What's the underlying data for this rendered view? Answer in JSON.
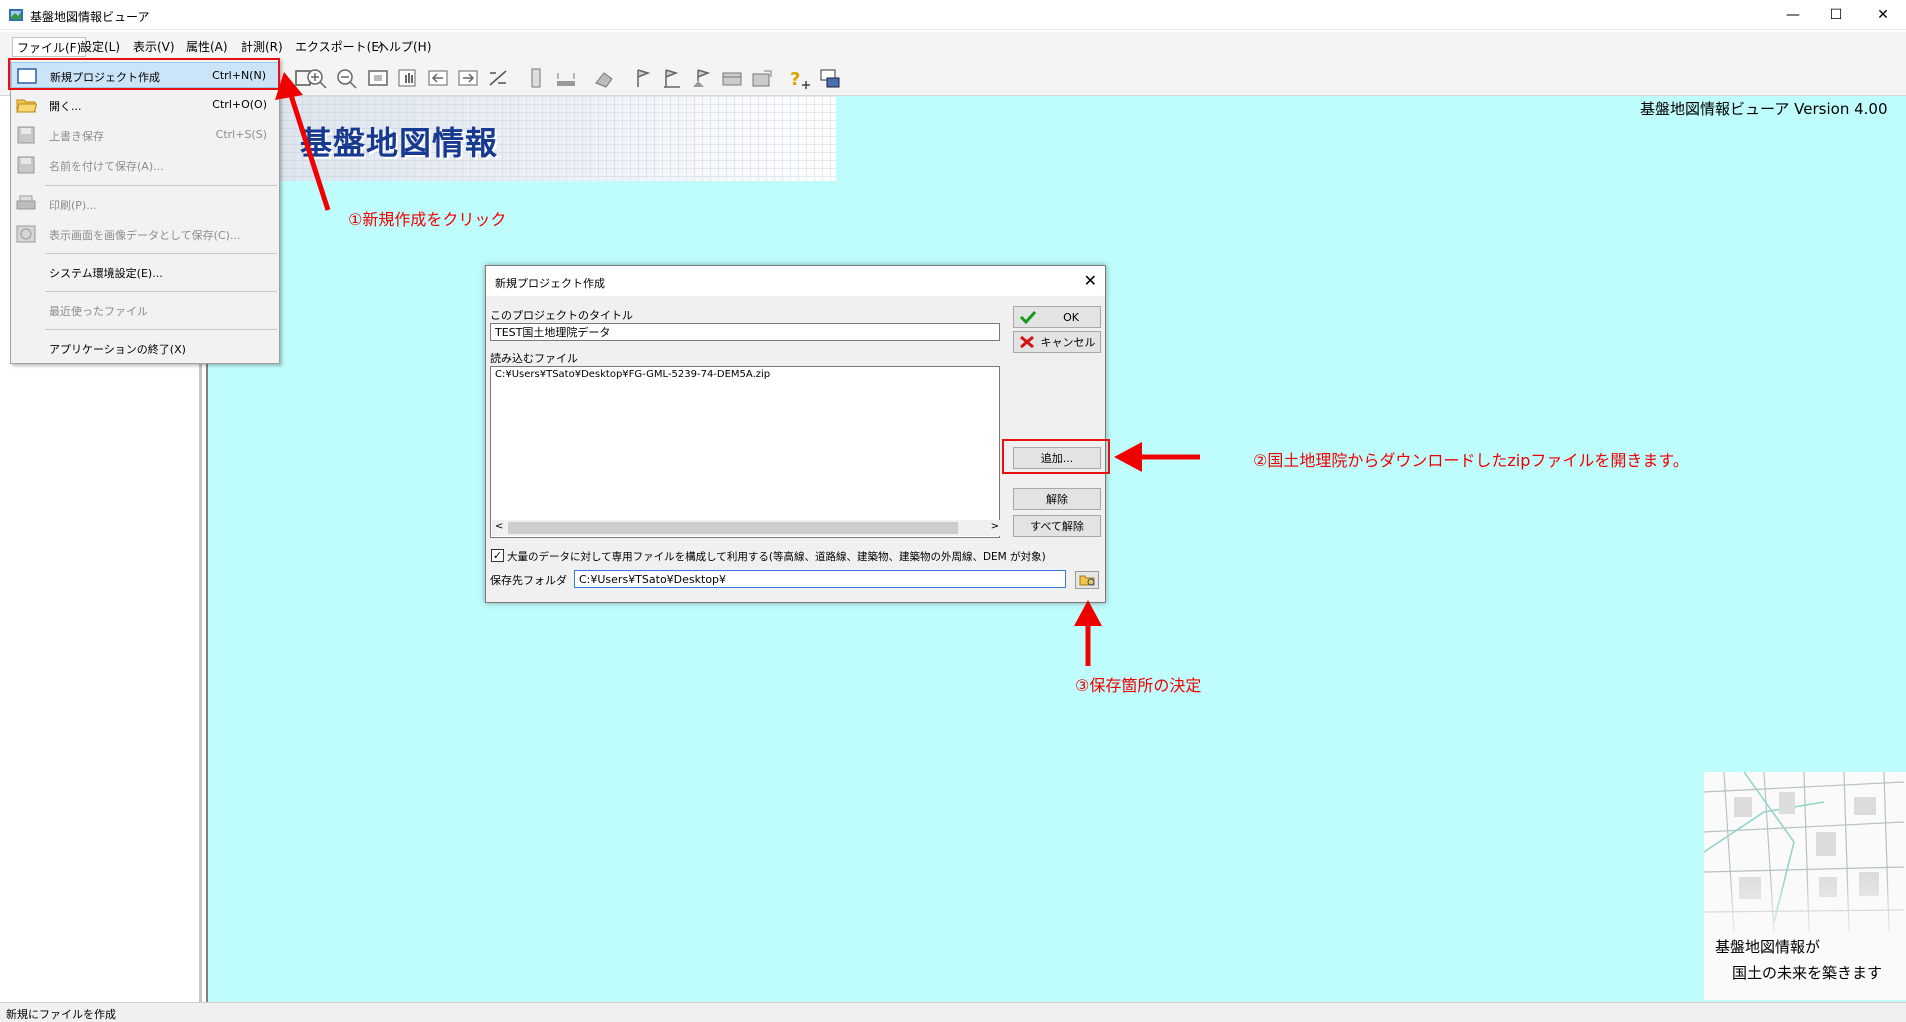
{
  "window": {
    "title": "基盤地図情報ビューア",
    "minimize": "—",
    "maximize": "☐",
    "close": "✕"
  },
  "menu": [
    {
      "label": "ファイル(F)"
    },
    {
      "label": "設定(L)"
    },
    {
      "label": "表示(V)"
    },
    {
      "label": "属性(A)"
    },
    {
      "label": "計測(R)"
    },
    {
      "label": "エクスポート(E)"
    },
    {
      "label": "ヘルプ(H)"
    }
  ],
  "file_menu": {
    "new_project": {
      "label": "新規プロジェクト作成",
      "shortcut": "Ctrl+N(N)"
    },
    "open": {
      "label": "開く...",
      "shortcut": "Ctrl+O(O)"
    },
    "save": {
      "label": "上書き保存",
      "shortcut": "Ctrl+S(S)"
    },
    "save_as": {
      "label": "名前を付けて保存(A)..."
    },
    "print": {
      "label": "印刷(P)..."
    },
    "save_image": {
      "label": "表示画面を画像データとして保存(C)..."
    },
    "settings": {
      "label": "システム環境設定(E)..."
    },
    "recent": {
      "label": "最近使ったファイル"
    },
    "exit": {
      "label": "アプリケーションの終了(X)"
    }
  },
  "banner": {
    "title": "基盤地図情報"
  },
  "version_text": "基盤地図情報ビューア Version 4.00",
  "bottom_logo": {
    "line1": "基盤地図情報が",
    "line2": "国土の未来を築きます"
  },
  "status_bar": "新規にファイルを作成",
  "dialog": {
    "title": "新規プロジェクト作成",
    "close": "✕",
    "project_title_label": "このプロジェクトのタイトル",
    "project_title_value": "TEST国土地理院データ",
    "files_label": "読み込むファイル",
    "files": [
      "C:¥Users¥TSato¥Desktop¥FG-GML-5239-74-DEM5A.zip"
    ],
    "ok": "OK",
    "cancel": "キャンセル",
    "add": "追加...",
    "remove": "解除",
    "remove_all": "すべて解除",
    "checkbox_label": "大量のデータに対して専用ファイルを構成して利用する(等高線、道路線、建築物、建築物の外周線、DEM が対象)",
    "checkbox_checked": "✓",
    "save_folder_label": "保存先フォルダ",
    "save_folder_value": "C:¥Users¥TSato¥Desktop¥",
    "scroll_left": "<",
    "scroll_right": ">"
  },
  "annotations": {
    "step1": "①新規作成をクリック",
    "step2": "②国土地理院からダウンロードしたzipファイルを開きます。",
    "step3": "③保存箇所の決定"
  },
  "colors": {
    "map_background": "#bffdfd",
    "annotation_red": "#f00000",
    "banner_title": "#17398f"
  },
  "icons": [
    "app-icon",
    "new-document-icon",
    "open-folder-icon",
    "save-icon",
    "save-as-icon",
    "print-icon",
    "save-image-icon",
    "zoom-in-icon",
    "zoom-out-icon",
    "fit-icon",
    "pan-hand-icon",
    "back-icon",
    "forward-icon",
    "measure-icon",
    "ruler-icon",
    "flag-icon",
    "help-icon",
    "checkmark-icon",
    "cancel-x-icon",
    "folder-browse-icon"
  ]
}
